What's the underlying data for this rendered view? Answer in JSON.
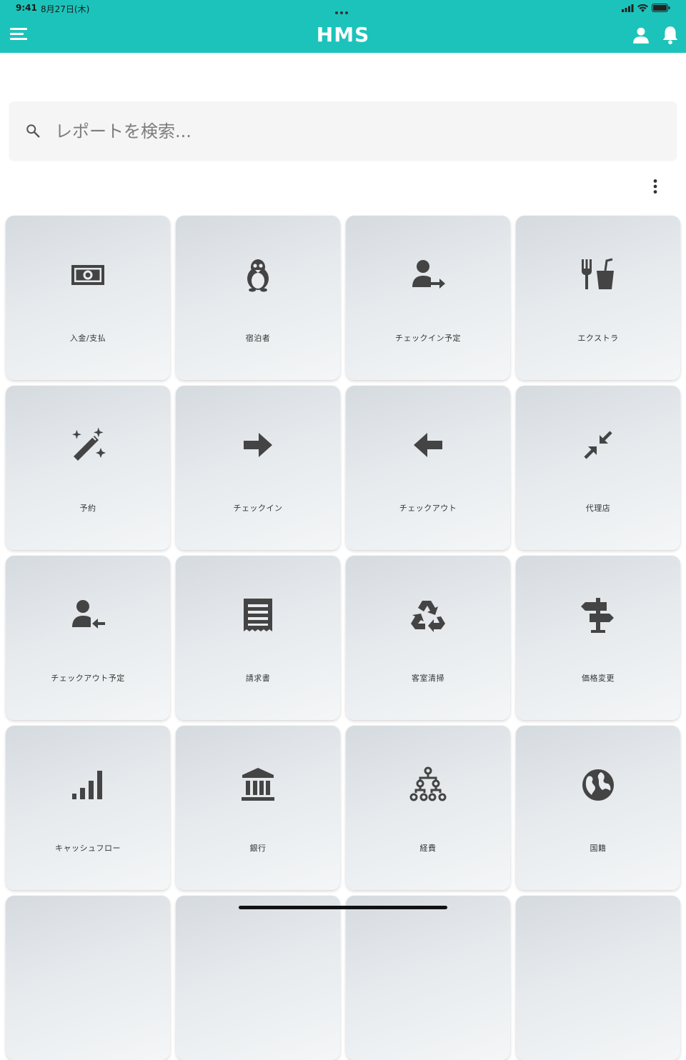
{
  "status_bar": {
    "time": "9:41",
    "date": "8月27日(木)"
  },
  "app_bar": {
    "title": "HMS",
    "accent": "#1cc3bb"
  },
  "search": {
    "placeholder": "レポートを検索...",
    "value": ""
  },
  "tiles": [
    {
      "label": "入金/支払",
      "icon": "money-icon"
    },
    {
      "label": "宿泊者",
      "icon": "penguin-icon"
    },
    {
      "label": "チェックイン予定",
      "icon": "user-arrow-right-icon"
    },
    {
      "label": "エクストラ",
      "icon": "food-drink-icon"
    },
    {
      "label": "予約",
      "icon": "magic-wand-icon"
    },
    {
      "label": "チェックイン",
      "icon": "arrow-right-icon"
    },
    {
      "label": "チェックアウト",
      "icon": "arrow-left-icon"
    },
    {
      "label": "代理店",
      "icon": "compress-icon"
    },
    {
      "label": "チェックアウト予定",
      "icon": "user-arrow-left-icon"
    },
    {
      "label": "請求書",
      "icon": "receipt-icon"
    },
    {
      "label": "客室清掃",
      "icon": "recycle-icon"
    },
    {
      "label": "価格変更",
      "icon": "signpost-icon"
    },
    {
      "label": "キャッシュフロー",
      "icon": "signal-bars-icon"
    },
    {
      "label": "銀行",
      "icon": "bank-icon"
    },
    {
      "label": "経費",
      "icon": "hierarchy-icon"
    },
    {
      "label": "国籍",
      "icon": "globe-icon"
    }
  ]
}
